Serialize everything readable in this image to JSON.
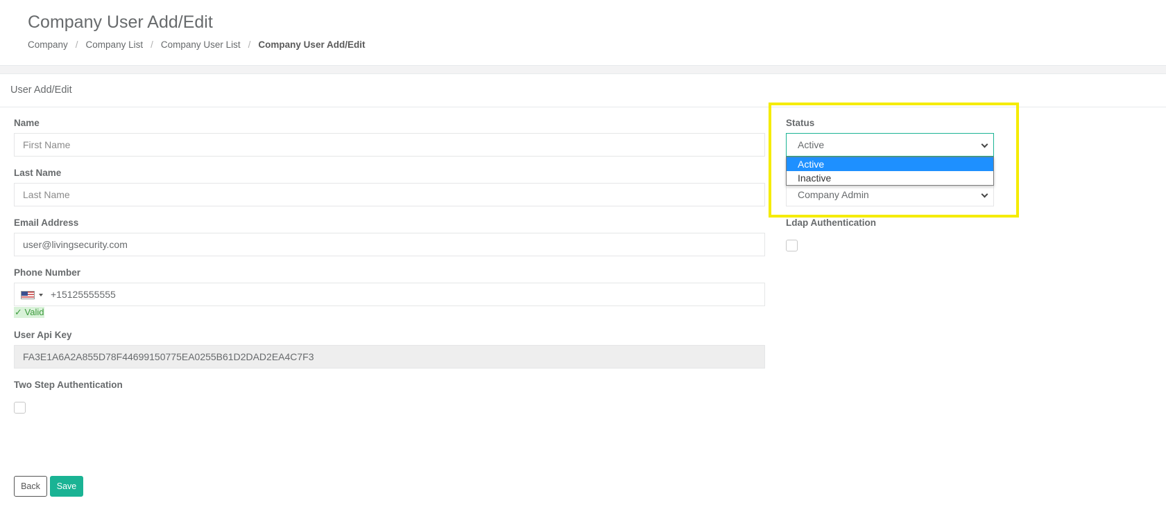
{
  "header": {
    "title": "Company User Add/Edit",
    "breadcrumb": [
      {
        "label": "Company"
      },
      {
        "label": "Company List"
      },
      {
        "label": "Company User List"
      },
      {
        "label": "Company User Add/Edit"
      }
    ],
    "separator": "/"
  },
  "panel": {
    "title": "User Add/Edit"
  },
  "form": {
    "name": {
      "label": "Name",
      "placeholder": "First Name"
    },
    "last_name": {
      "label": "Last Name",
      "placeholder": "Last Name"
    },
    "email": {
      "label": "Email Address",
      "value": "user@livingsecurity.com"
    },
    "phone": {
      "label": "Phone Number",
      "value": "+15125555555",
      "country_icon": "us-flag-icon",
      "validation": "✓ Valid"
    },
    "api_key": {
      "label": "User Api Key",
      "value": "FA3E1A6A2A855D78F44699150775EA0255B61D2DAD2EA4C7F3"
    },
    "two_step": {
      "label": "Two Step Authentication",
      "checked": false
    },
    "status": {
      "label": "Status",
      "value": "Active",
      "options": [
        "Active",
        "Inactive"
      ],
      "open": true,
      "selected_option": "Active"
    },
    "role": {
      "value": "Company Admin"
    },
    "ldap": {
      "label": "Ldap Authentication",
      "checked": false
    }
  },
  "actions": {
    "back_label": "Back",
    "save_label": "Save"
  },
  "colors": {
    "primary": "#1ab394",
    "highlight": "#f5ec00",
    "dropdown_selected": "#1e90ff",
    "valid_bg": "#d9f2d9"
  }
}
